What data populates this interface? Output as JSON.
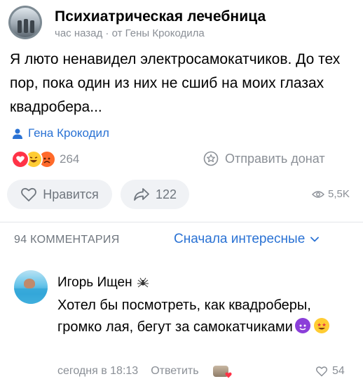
{
  "post": {
    "group_name": "Психиатрическая лечебница",
    "meta": "час назад · от Гены Крокодила",
    "text": "Я люто ненавидел электросамокатчиков. До тех пор, пока один из них не сшиб на моих глазах квадробера...",
    "author_link": "Гена Крокодил",
    "reaction_count": "264",
    "donate_label": "Отправить донат",
    "like_label": "Нравится",
    "share_count": "122",
    "views": "5,5K"
  },
  "comments_section": {
    "count_label": "94 КОММЕНТАРИЯ",
    "sort_label": "Сначала интересные"
  },
  "comment": {
    "author": "Игорь Ищен",
    "text": "Хотел бы посмотреть, как квадроберы, громко лая, бегут за самокатчиками",
    "time": "сегодня в 18:13",
    "reply_label": "Ответить",
    "likes": "54"
  },
  "colors": {
    "accent": "#2a72d4",
    "muted": "#8a8f96",
    "pill_bg": "#f0f2f5"
  }
}
